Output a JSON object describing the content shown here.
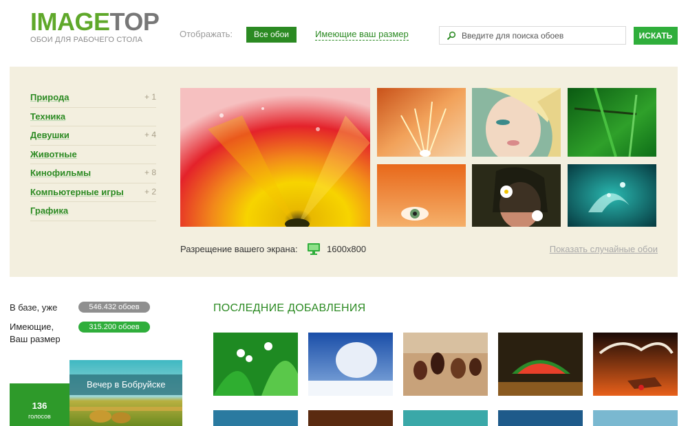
{
  "header": {
    "logo_part1": "IMAGE",
    "logo_part2": "TOP",
    "logo_tagline": "ОБОИ ДЛЯ РАБОЧЕГО СТОЛА",
    "display_label": "Отображать:",
    "all_wallpapers": "Все обои",
    "your_size": "Имеющие ваш размер",
    "search_placeholder": "Введите для поиска обоев",
    "search_button": "ИСКАТЬ"
  },
  "categories": [
    {
      "label": "Природа",
      "count": "+ 1"
    },
    {
      "label": "Техника",
      "count": ""
    },
    {
      "label": "Девушки",
      "count": "+ 4"
    },
    {
      "label": "Животные",
      "count": ""
    },
    {
      "label": "Кинофильмы",
      "count": "+ 8"
    },
    {
      "label": "Компьютерные игры",
      "count": "+ 2"
    },
    {
      "label": "Графика",
      "count": ""
    }
  ],
  "resolution": {
    "label": "Разрещение вашего экрана:",
    "icon": "monitor-icon",
    "value": "1600x800",
    "random_link": "Показать случайные обои"
  },
  "stats": {
    "in_base_label": "В базе, уже",
    "in_base_value": "546.432 обоев",
    "your_size_label_1": "Имеющие,",
    "your_size_label_2": "Ваш размер",
    "your_size_value": "315.200 обоев"
  },
  "featured": {
    "title": "Вечер в Бобруйске",
    "votes": "136",
    "votes_caption": "голосов"
  },
  "latest": {
    "title": "ПОСЛЕДНИЕ ДОБАВЛЕНИЯ"
  },
  "colors": {
    "brand_green": "#2b8a22",
    "button_green": "#2fae3b",
    "panel_beige": "#f3efdf"
  }
}
